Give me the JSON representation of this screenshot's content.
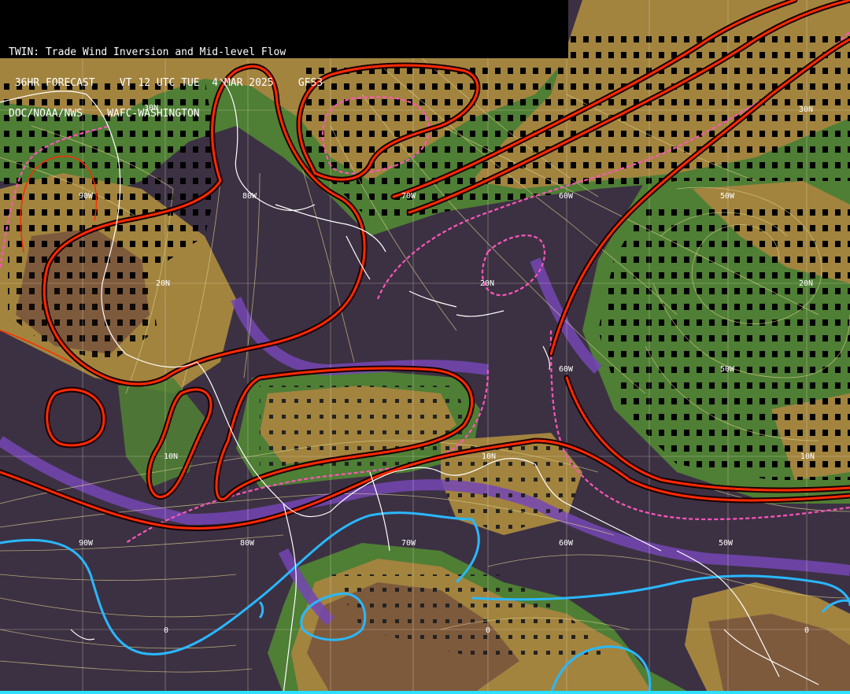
{
  "header": {
    "line1": "TWIN: Trade Wind Inversion and Mid-level Flow",
    "line2": " 36HR FORECAST    VT 12 UTC TUE  4 MAR 2025    GFS3",
    "line3": "DOC/NOAA/NWS    WAFC-WASHINGTON"
  },
  "latitude_labels": [
    "30N",
    "30N",
    "20N",
    "20N",
    "20N",
    "10N",
    "10N",
    "10N",
    "0",
    "0",
    "0"
  ],
  "longitude_labels": [
    "90W",
    "80W",
    "70W",
    "60W",
    "50W",
    "60W",
    "50W",
    "90W",
    "80W",
    "70W",
    "60W",
    "50W"
  ],
  "colors": {
    "background": "#3c3143",
    "moist_green": "#4f7e35",
    "dry_tan": "#a2843f",
    "dark_brown": "#7e5a3d",
    "purple_band": "#7446b4",
    "red_contour": "#ff2a00",
    "magenta_dashed": "#ff55bb",
    "cyan_contour": "#2ab8ff",
    "streamlines": "#d9d08a",
    "coastlines": "#ffffff",
    "grid": "#e8e0c0"
  }
}
